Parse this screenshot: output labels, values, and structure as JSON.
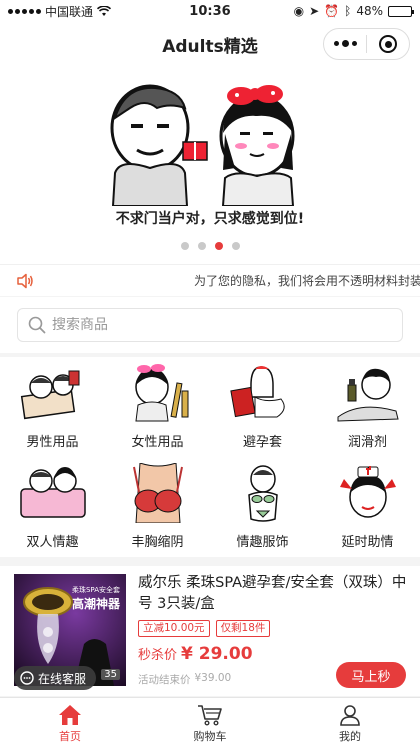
{
  "status_bar": {
    "carrier": "中国联通",
    "time": "10:36",
    "battery": "48%",
    "battery_level": 0.48
  },
  "nav": {
    "title": "Adults精选",
    "menu_icon": "more-dots-icon",
    "close_icon": "target-icon"
  },
  "banner": {
    "caption": "不求门当户对，只求感觉到位!",
    "slide_count": 4,
    "active_slide": 3
  },
  "notice": {
    "icon": "speaker-icon",
    "text": "为了您的隐私，我们将会用不透明材料封装"
  },
  "search": {
    "placeholder": "搜索商品",
    "icon": "search-icon"
  },
  "categories": [
    {
      "label": "男性用品"
    },
    {
      "label": "女性用品"
    },
    {
      "label": "避孕套"
    },
    {
      "label": "润滑剂"
    },
    {
      "label": "双人情趣"
    },
    {
      "label": "丰胸缩阴"
    },
    {
      "label": "情趣服饰"
    },
    {
      "label": "延时助情"
    }
  ],
  "product": {
    "name": "威尔乐 柔珠SPA避孕套/安全套（双珠）中号 3只装/盒",
    "image_text_small": "柔珠SPA安全套",
    "image_text_big": "高潮神器",
    "tags": [
      "立减10.00元",
      "仅剩18件"
    ],
    "price_label": "秒杀价",
    "price": "¥ 29.00",
    "original_label": "活动结束价",
    "original_price": "¥39.00",
    "buy_label": "马上秒",
    "badge": "35"
  },
  "service": {
    "label": "在线客服"
  },
  "tabs": [
    {
      "label": "首页",
      "icon": "home-icon",
      "active": true
    },
    {
      "label": "购物车",
      "icon": "cart-icon",
      "active": false
    },
    {
      "label": "我的",
      "icon": "user-icon",
      "active": false
    }
  ],
  "colors": {
    "accent": "#e63c3c",
    "background": "#f4f4f4"
  }
}
